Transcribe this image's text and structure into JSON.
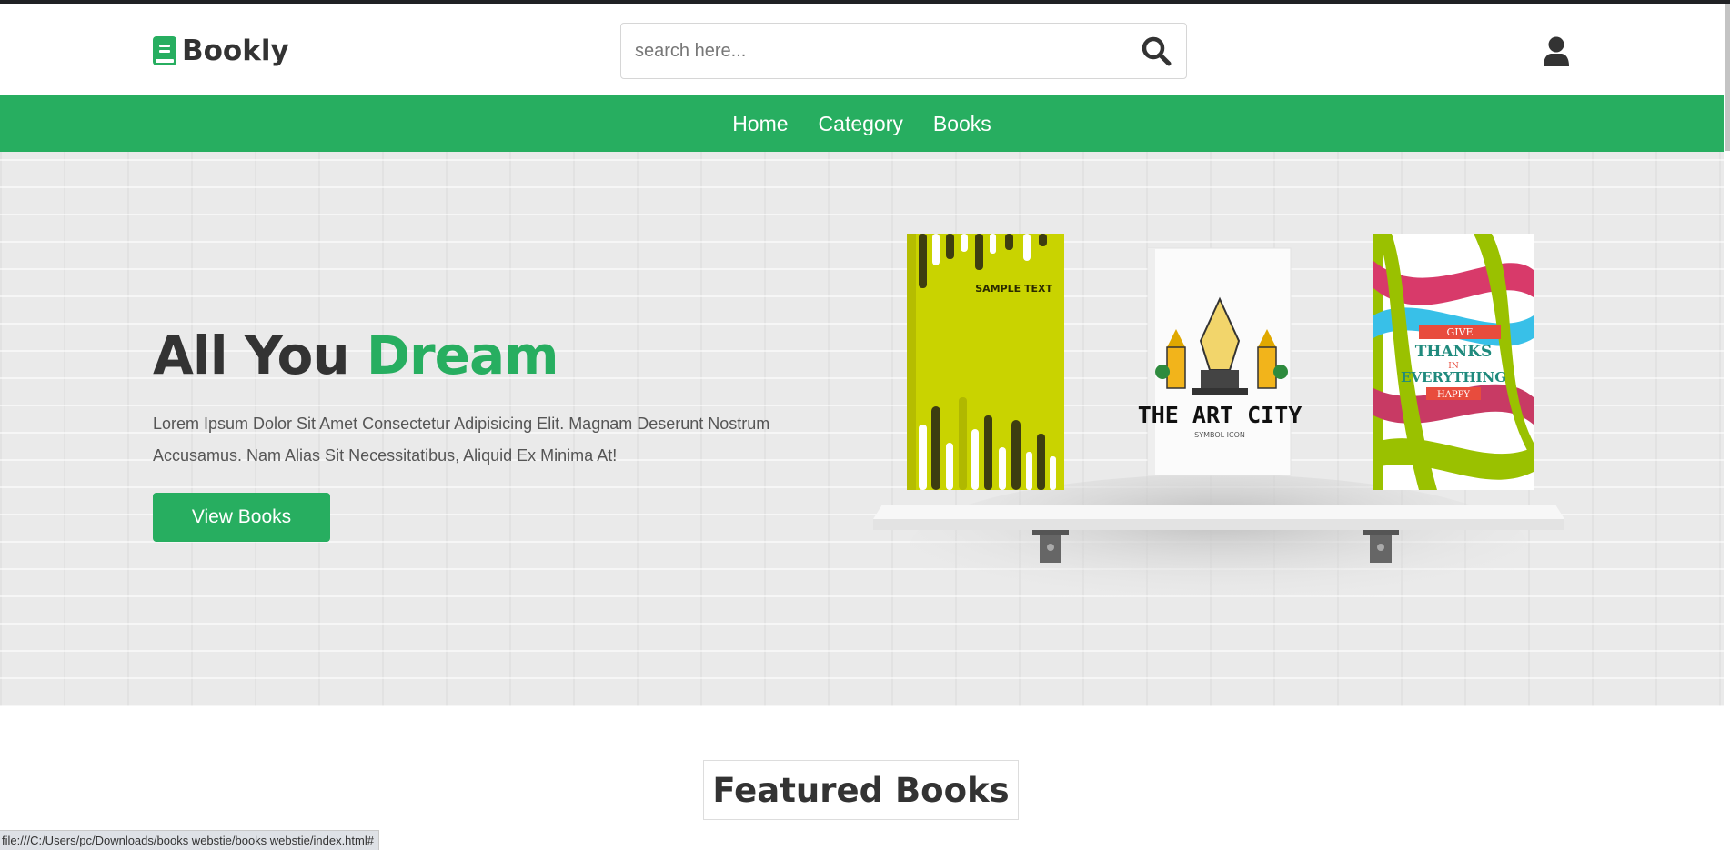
{
  "header": {
    "brand": "Bookly",
    "search_placeholder": "search here..."
  },
  "nav": {
    "items": [
      {
        "label": "Home"
      },
      {
        "label": "Category"
      },
      {
        "label": "Books"
      }
    ]
  },
  "hero": {
    "title_part1": "All You ",
    "title_accent": "Dream",
    "description": "Lorem Ipsum Dolor Sit Amet Consectetur Adipisicing Elit. Magnam Deserunt Nostrum Accusamus. Nam Alias Sit Necessitatibus, Aliquid Ex Minima At!",
    "button_label": "View Books",
    "books": [
      {
        "cover_text": "SAMPLE TEXT"
      },
      {
        "cover_text": "THE ART CITY",
        "cover_subtext": "SYMBOL ICON"
      },
      {
        "cover_text_lines": [
          "GIVE",
          "THANKS",
          "IN",
          "EVERYTHING",
          "HAPPY"
        ]
      }
    ]
  },
  "featured": {
    "heading": "Featured Books"
  },
  "status_bar": {
    "url": "file:///C:/Users/pc/Downloads/books webstie/books webstie/index.html#"
  },
  "colors": {
    "accent": "#27ae60",
    "text_dark": "#333333",
    "hero_bg": "#eaeaea"
  },
  "icons": {
    "logo": "book-icon",
    "search": "search-icon",
    "user": "user-icon"
  }
}
